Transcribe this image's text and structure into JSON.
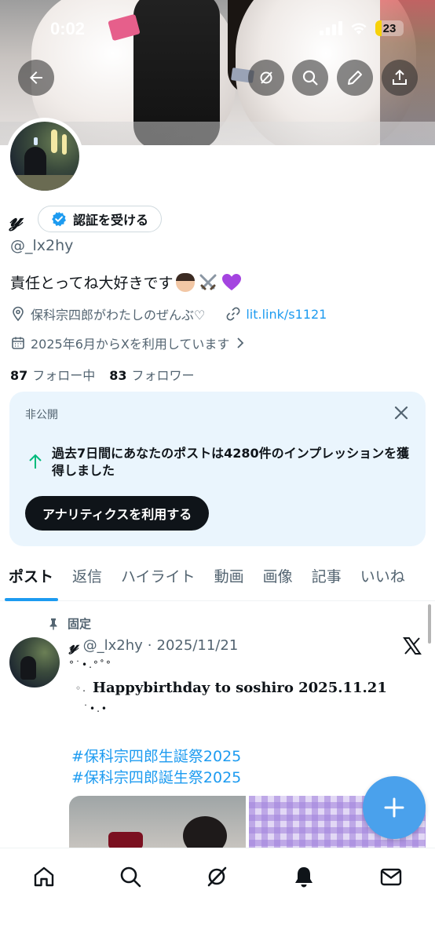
{
  "status_bar": {
    "time": "0:02",
    "battery": "23",
    "battery_level": 0.23
  },
  "banner_buttons": [
    "back-arrow-icon",
    "grok-icon",
    "search-icon",
    "edit-pencil-icon",
    "share-icon"
  ],
  "profile": {
    "name_logo": "𝓎",
    "verify_label": "認証を受ける",
    "handle": "@_lx2hy",
    "bio": "責任とってね大好きです",
    "location": "保科宗四郎がわたしのぜんぶ♡",
    "link": "lit.link/s1121",
    "joined": "2025年6月からXを利用しています",
    "following_count": "87",
    "following_label": "フォロー中",
    "followers_count": "83",
    "followers_label": "フォロワー"
  },
  "private_card": {
    "label": "非公開",
    "message": "過去7日間にあなたのポストは4280件のインプレッションを獲得しました",
    "cta": "アナリティクスを利用する"
  },
  "tabs": [
    "ポスト",
    "返信",
    "ハイライト",
    "動画",
    "画像",
    "記事",
    "いいね"
  ],
  "post": {
    "pinned_label": "固定",
    "author_logo": "𝓎",
    "handle": "@_lx2hy",
    "separator": "·",
    "date": "2025/11/21",
    "dots_top": "°˙•.°˚°",
    "dots_left": "◦.",
    "title": "Happybirthday to soshiro 2025.11.21",
    "dots_bottom": "˙•.•",
    "hashtag1": "#保科宗四郎生誕祭2025",
    "hashtag2": "#保科宗四郎誕生祭2025"
  },
  "bottom_nav": [
    "home-icon",
    "search-icon",
    "grok-icon",
    "notifications-bell-icon",
    "messages-envelope-icon"
  ],
  "colors": {
    "accent": "#1d9bf0",
    "card_bg": "#eaf5fd",
    "fab": "#4aa1ec",
    "text": "#0f1419",
    "secondary": "#536471"
  }
}
